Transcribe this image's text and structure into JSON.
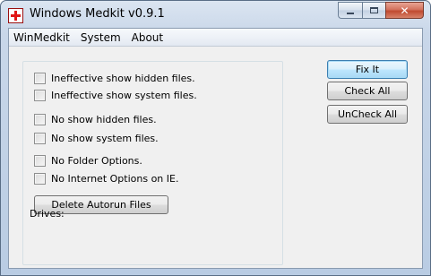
{
  "window": {
    "title": "Windows Medkit v0.9.1",
    "icon": "red-cross-icon",
    "controls": {
      "close_glyph": "✕"
    }
  },
  "menu": {
    "items": [
      "WinMedkit",
      "System",
      "About"
    ]
  },
  "options": [
    {
      "label": "Ineffective show hidden files.",
      "checked": false
    },
    {
      "label": "Ineffective show system files.",
      "checked": false
    },
    {
      "label": "No show hidden files.",
      "checked": false
    },
    {
      "label": "No show system files.",
      "checked": false
    },
    {
      "label": "No Folder Options.",
      "checked": false
    },
    {
      "label": "No Internet Options on IE.",
      "checked": false
    }
  ],
  "actions": {
    "delete_autorun": "Delete Autorun Files",
    "drives_label": "Drives:",
    "fix_it": "Fix It",
    "check_all": "Check All",
    "uncheck_all": "UnCheck All"
  },
  "colors": {
    "title_bar": "#c9d7e9",
    "client_bg": "#f0f0f0",
    "close_button": "#c04a30",
    "default_button_border": "#3c7fb1"
  }
}
